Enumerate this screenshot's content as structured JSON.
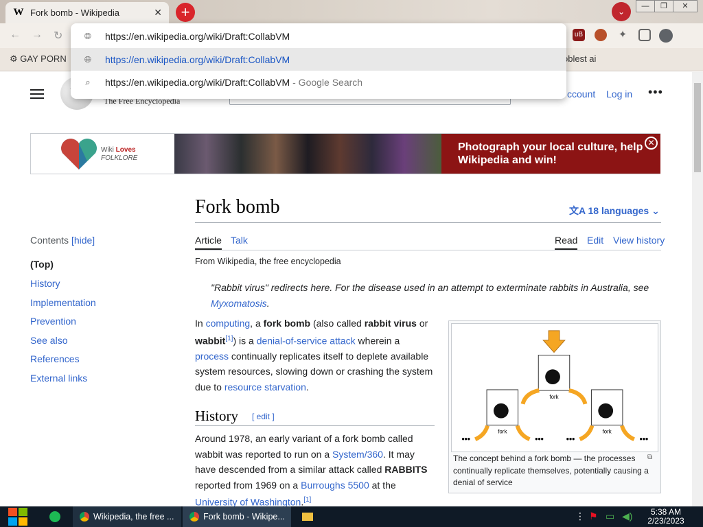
{
  "browser": {
    "tab_title": "Fork bomb - Wikipedia",
    "tab_favicon": "W",
    "tab_close": "✕",
    "new_tab": "+",
    "profile_chevron": "⌄",
    "window_controls": {
      "minimize": "—",
      "maximize": "❐",
      "close": "✕"
    },
    "nav": {
      "back": "←",
      "forward": "→",
      "reload": "↻"
    },
    "bookmarks": {
      "first": "GAY PORN",
      "last": "oblest ai"
    },
    "omnibox": {
      "input_text": "https://en.wikipedia.org/wiki/Draft:CollabVM",
      "suggestion_url": "https://en.wikipedia.org/wiki/Draft:CollabVM",
      "suggestion_search": "https://en.wikipedia.org/wiki/Draft:CollabVM",
      "suggestion_search_suffix": " - Google Search"
    },
    "extensions": {
      "ublock": "uB"
    }
  },
  "wiki_header": {
    "logo_glyph": "W",
    "tagline": "The Free Encyclopedia",
    "account_link": "ccount",
    "login_link": "Log in",
    "more": "•••"
  },
  "banner": {
    "logo_line1_prefix": "Wiki ",
    "logo_line1_bold": "Loves",
    "logo_line2": "FOLKLORE",
    "promo_text": "Photograph your local culture, help Wikipedia and win!",
    "close": "✕"
  },
  "article": {
    "title": "Fork bomb",
    "languages": "18 languages",
    "tabs": {
      "article": "Article",
      "talk": "Talk",
      "read": "Read",
      "edit": "Edit",
      "history": "View history"
    },
    "from": "From Wikipedia, the free encyclopedia",
    "hatnote": "\"Rabbit virus\" redirects here. For the disease used in an attempt to exterminate rabbits in Australia, see",
    "hatnote_link": "Myxomatosis",
    "hatnote_end": ".",
    "intro": {
      "p1": "In ",
      "l_computing": "computing",
      "p2": ", a ",
      "b_fork_bomb": "fork bomb",
      "p3": " (also called ",
      "b_rabbit": "rabbit virus",
      "p4": " or ",
      "b_wabbit": "wabbit",
      "sup1": "[1]",
      "p5": ") is a ",
      "l_dos": "denial-of-service attack",
      "p6": " wherein a ",
      "l_process": "process",
      "p7": " continually replicates itself to deplete available system resources, slowing down or crashing the system due to ",
      "l_starvation": "resource starvation",
      "p8": "."
    },
    "history_heading": "History",
    "history_edit": "[ edit ]",
    "history": {
      "p1": "Around 1978, an early variant of a fork bomb called wabbit was reported to run on a ",
      "l_system360": "System/360",
      "p2": ". It may have descended from a similar attack called ",
      "b_rabbits": "RABBITS",
      "p3": " reported from 1969 on a ",
      "l_burroughs": "Burroughs 5500",
      "p4": " at the ",
      "l_uw": "University of Washington",
      "p5": ".",
      "sup": "[1]"
    },
    "figure": {
      "caption": "The concept behind a fork bomb — the processes continually replicate themselves, potentially causing a denial of service",
      "fork_label": "fork",
      "dots": "•••"
    }
  },
  "toc": {
    "heading": "Contents",
    "hide": "[hide]",
    "items": [
      "(Top)",
      "History",
      "Implementation",
      "Prevention",
      "See also",
      "References",
      "External links"
    ]
  },
  "taskbar": {
    "items": [
      {
        "label": "Wikipedia, the free ..."
      },
      {
        "label": "Fork bomb - Wikipe..."
      }
    ],
    "time": "5:38 AM",
    "date": "2/23/2023"
  }
}
